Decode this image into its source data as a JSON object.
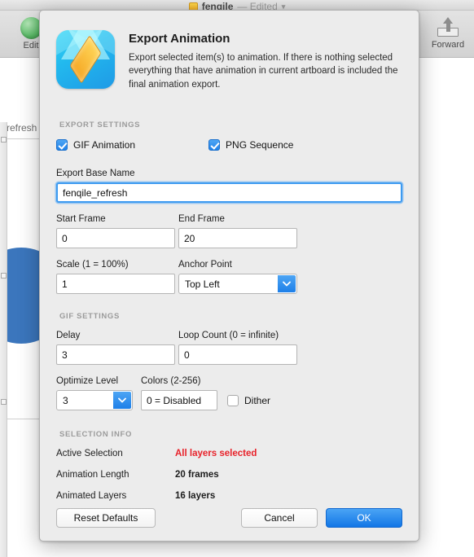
{
  "background": {
    "window_title": "fenqile",
    "window_edited_label": "— Edited",
    "toolbar": {
      "edit_label": "Edit",
      "forward_label": "Forward"
    },
    "canvas_label": "refresh"
  },
  "dialog": {
    "title": "Export Animation",
    "description": "Export selected item(s) to animation. If there is nothing selected everything that have animation in current artboard is included the final animation export.",
    "sections": {
      "export_settings": "EXPORT SETTINGS",
      "gif_settings": "GIF SETTINGS",
      "selection_info": "SELECTION INFO"
    },
    "checkboxes": {
      "gif_animation_label": "GIF Animation",
      "gif_animation_checked": "checked",
      "png_sequence_label": "PNG Sequence",
      "png_sequence_checked": "checked",
      "dither_label": "Dither",
      "dither_checked": "unchecked"
    },
    "fields": {
      "base_name_label": "Export Base Name",
      "base_name_value": "fenqile_refresh",
      "start_frame_label": "Start Frame",
      "start_frame_value": "0",
      "end_frame_label": "End Frame",
      "end_frame_value": "20",
      "scale_label": "Scale (1 = 100%)",
      "scale_value": "1",
      "anchor_point_label": "Anchor Point",
      "anchor_point_value": "Top Left",
      "delay_label": "Delay",
      "delay_value": "3",
      "loop_count_label": "Loop Count (0 = infinite)",
      "loop_count_value": "0",
      "optimize_level_label": "Optimize Level",
      "optimize_level_value": "3",
      "colors_label": "Colors (2-256)",
      "colors_value": "0 = Disabled"
    },
    "selection_info": [
      {
        "key": "Active Selection",
        "value": "All layers selected",
        "style": "alert"
      },
      {
        "key": "Animation Length",
        "value": "20 frames",
        "style": "normal"
      },
      {
        "key": "Animated Layers",
        "value": "16 layers",
        "style": "normal"
      }
    ],
    "buttons": {
      "reset": "Reset Defaults",
      "cancel": "Cancel",
      "ok": "OK"
    },
    "colors": {
      "accent": "#1d7fe8",
      "alert": "#e8222a",
      "dialog_bg": "#ececec"
    }
  }
}
